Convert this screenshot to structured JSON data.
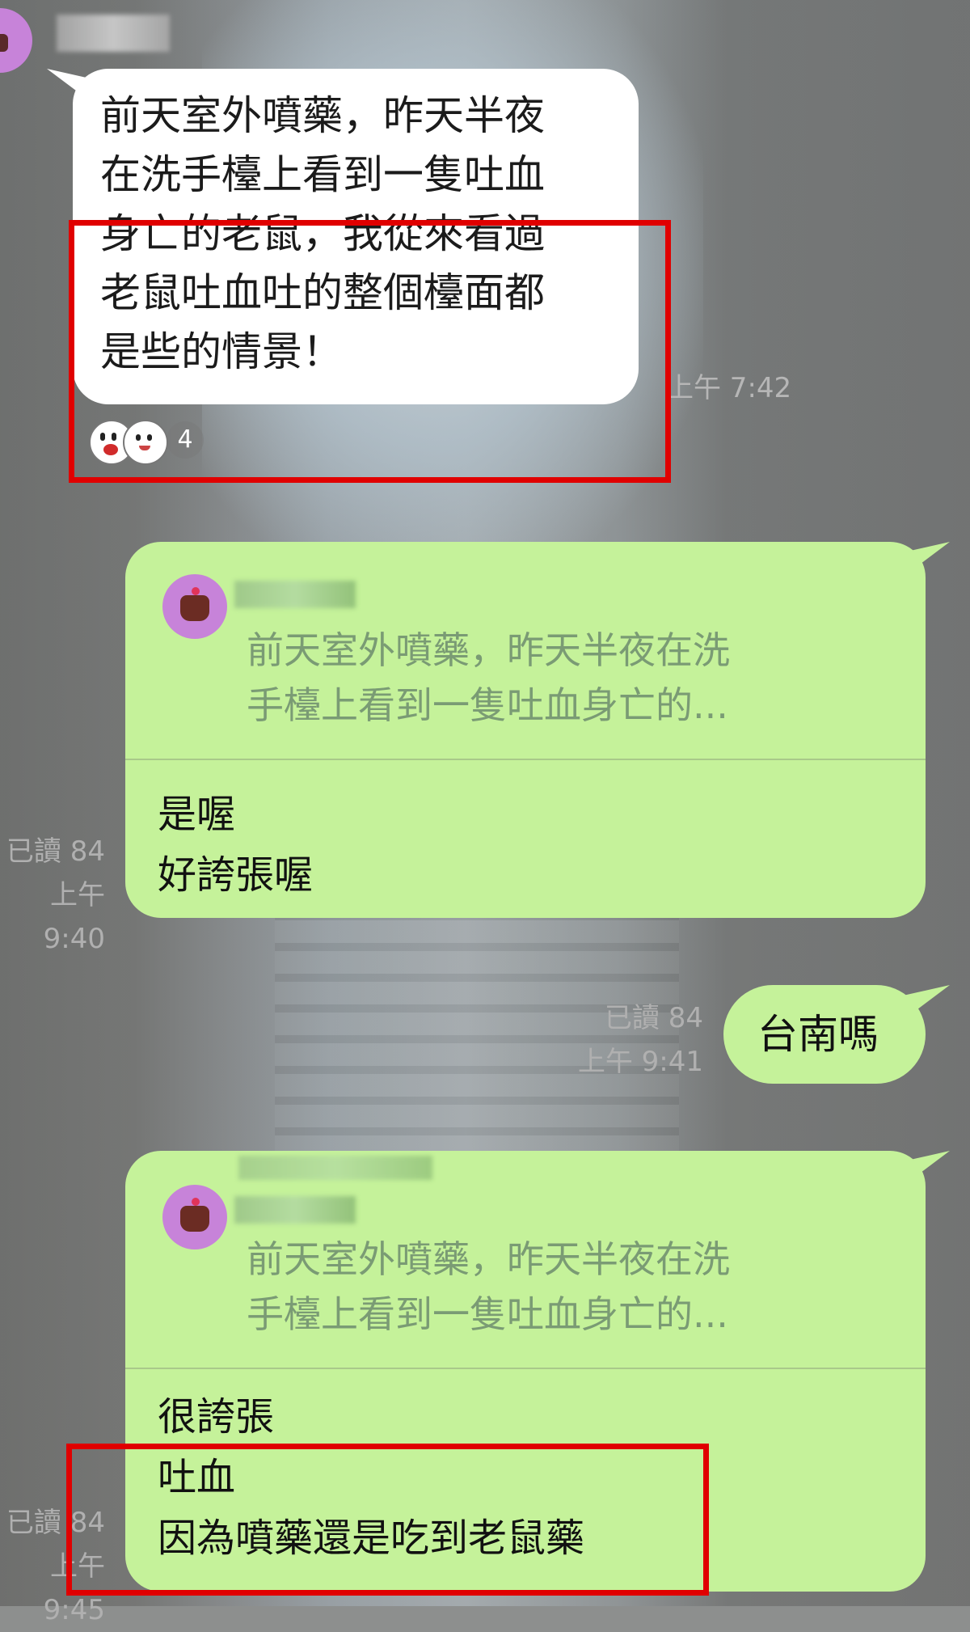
{
  "conversation": {
    "incoming": {
      "text": "前天室外噴藥，昨天半夜\n在洗手檯上看到一隻吐血\n身亡的老鼠，我從來看過\n老鼠吐血吐的整個檯面都\n是些的情景！",
      "time": "上午 7:42",
      "reaction_count": "4",
      "reaction_icons": [
        "shocked-face-icon",
        "worried-face-icon"
      ]
    },
    "reply1": {
      "quote": "前天室外噴藥，昨天半夜在洗\n手檯上看到一隻吐血身亡的...",
      "body": "是喔\n好誇張喔",
      "read": "已讀 84",
      "time": "上午 9:40"
    },
    "msg2": {
      "text": "台南嗎",
      "read": "已讀 84",
      "time": "上午 9:41"
    },
    "reply2": {
      "quote": "前天室外噴藥，昨天半夜在洗\n手檯上看到一隻吐血身亡的...",
      "body": "很誇張\n吐血\n因為噴藥還是吃到老鼠藥",
      "read": "已讀 84",
      "time": "上午 9:45"
    }
  },
  "colors": {
    "outgoing_bubble": "#c5f29a",
    "incoming_bubble": "#ffffff",
    "highlight_box": "#e00000"
  }
}
